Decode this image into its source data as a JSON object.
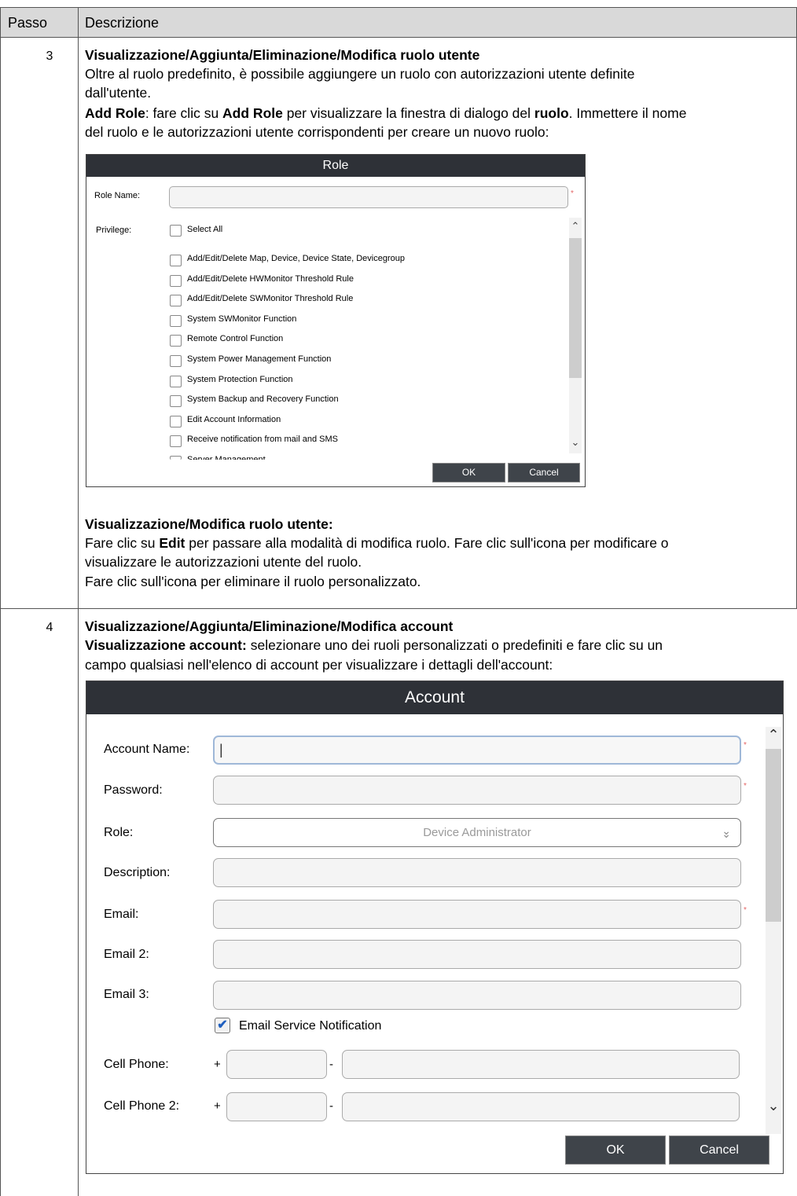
{
  "table": {
    "header_step": "Passo",
    "header_desc": "Descrizione"
  },
  "row3": {
    "step": "3",
    "title": "Visualizzazione/Aggiunta/Eliminazione/Modifica ruolo utente",
    "line1": "Oltre al ruolo predefinito, è possibile aggiungere un ruolo con autorizzazioni utente definite",
    "line2": "dall'utente.",
    "add_role_label": "Add Role",
    "add_role_text1": ": fare clic su ",
    "add_role_text2": "Add Role",
    "add_role_text3": " per visualizzare la finestra di dialogo del ",
    "add_role_text4": "ruolo",
    "add_role_text5": ". Immettere il nome",
    "line4": "del ruolo e le autorizzazioni utente corrispondenti per creare un nuovo ruolo:",
    "view_title": "Visualizzazione/Modifica ruolo utente:",
    "view_line1a": "Fare clic su ",
    "view_line1b": "Edit",
    "view_line1c": " per passare alla modalità di modifica ruolo. Fare clic sull'icona per modificare o",
    "view_line2": "visualizzare le autorizzazioni utente del ruolo.",
    "view_line3": "Fare clic sull'icona per eliminare il ruolo personalizzato."
  },
  "role_dialog": {
    "title": "Role",
    "role_name_label": "Role Name:",
    "privilege_label": "Privilege:",
    "select_all": "Select All",
    "privileges": [
      "Add/Edit/Delete Map, Device, Device State, Devicegroup",
      "Add/Edit/Delete HWMonitor Threshold Rule",
      "Add/Edit/Delete SWMonitor Threshold Rule",
      "System SWMonitor Function",
      "Remote Control Function",
      "System Power Management Function",
      "System Protection Function",
      "System Backup and Recovery Function",
      "Edit Account Information",
      "Receive notification from mail and SMS",
      "Server Management"
    ],
    "ok": "OK",
    "cancel": "Cancel",
    "required_mark": "*"
  },
  "row4": {
    "step": "4",
    "title": "Visualizzazione/Aggiunta/Eliminazione/Modifica account",
    "line1a": "Visualizzazione account:",
    "line1b": " selezionare uno dei ruoli personalizzati o predefiniti e fare clic su un",
    "line2": "campo qualsiasi nell'elenco di account per visualizzare i dettagli dell'account:"
  },
  "account_dialog": {
    "title": "Account",
    "account_name_label": "Account Name:",
    "account_name_value": "|",
    "password_label": "Password:",
    "role_label": "Role:",
    "role_value": "Device Administrator",
    "description_label": "Description:",
    "email_label": "Email:",
    "email2_label": "Email 2:",
    "email3_label": "Email 3:",
    "email_service_notification": "Email Service Notification",
    "cell_phone_label": "Cell Phone:",
    "cell_phone2_label": "Cell Phone 2:",
    "plus": "+",
    "dash": "-",
    "ok": "OK",
    "cancel": "Cancel",
    "required_mark": "*"
  }
}
